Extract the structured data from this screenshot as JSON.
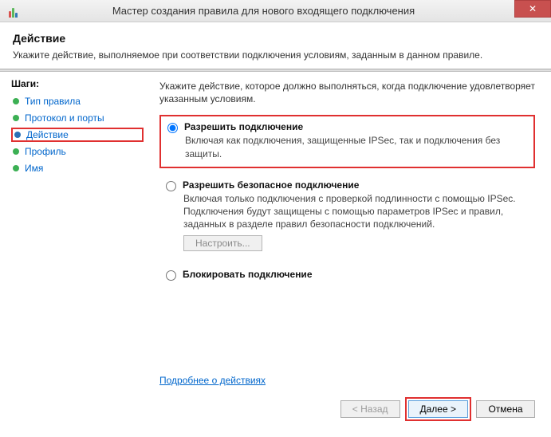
{
  "window": {
    "title": "Мастер создания правила для нового входящего подключения",
    "close_glyph": "✕"
  },
  "header": {
    "title": "Действие",
    "subtitle": "Укажите действие, выполняемое при соответствии подключения условиям, заданным в данном правиле."
  },
  "sidebar": {
    "steps_label": "Шаги:",
    "items": [
      {
        "label": "Тип правила"
      },
      {
        "label": "Протокол и порты"
      },
      {
        "label": "Действие"
      },
      {
        "label": "Профиль"
      },
      {
        "label": "Имя"
      }
    ]
  },
  "main": {
    "instruction": "Укажите действие, которое должно выполняться, когда подключение удовлетворяет указанным условиям.",
    "options": [
      {
        "title": "Разрешить подключение",
        "desc": "Включая как подключения, защищенные IPSec, так и подключения без защиты."
      },
      {
        "title": "Разрешить безопасное подключение",
        "desc": "Включая только подключения с проверкой подлинности с помощью IPSec. Подключения будут защищены с помощью параметров IPSec и правил, заданных в разделе правил безопасности подключений.",
        "configure_label": "Настроить..."
      },
      {
        "title": "Блокировать подключение",
        "desc": ""
      }
    ],
    "learn_more": "Подробнее о действиях"
  },
  "footer": {
    "back": "< Назад",
    "next": "Далее >",
    "cancel": "Отмена"
  }
}
